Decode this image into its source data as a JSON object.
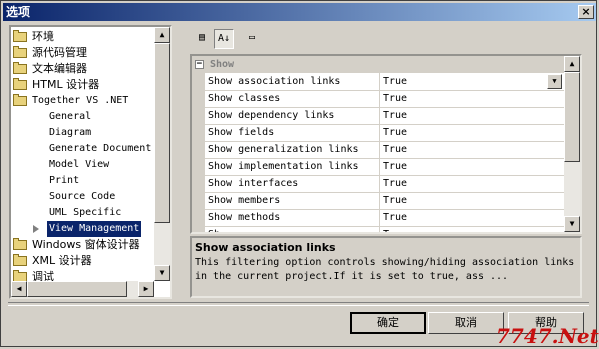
{
  "window": {
    "title": "选项",
    "close_glyph": "×"
  },
  "tree": {
    "items": [
      {
        "label": "环境"
      },
      {
        "label": "源代码管理"
      },
      {
        "label": "文本编辑器"
      },
      {
        "label": "HTML 设计器"
      },
      {
        "label": "Together VS .NET"
      },
      {
        "label": "General"
      },
      {
        "label": "Diagram"
      },
      {
        "label": "Generate Document"
      },
      {
        "label": "Model View"
      },
      {
        "label": "Print"
      },
      {
        "label": "Source Code"
      },
      {
        "label": "UML Specific"
      },
      {
        "label": "View Management"
      },
      {
        "label": "Windows 窗体设计器"
      },
      {
        "label": "XML 设计器"
      },
      {
        "label": "调试"
      }
    ],
    "selected": "View Management"
  },
  "toolbar": {
    "categorized_glyph": "▤",
    "alpha_glyph": "A↓",
    "pages_glyph": "▭"
  },
  "grid": {
    "category": "Show",
    "category_toggle": "−",
    "rows": [
      {
        "name": "Show association links",
        "value": "True"
      },
      {
        "name": "Show classes",
        "value": "True"
      },
      {
        "name": "Show dependency links",
        "value": "True"
      },
      {
        "name": "Show fields",
        "value": "True"
      },
      {
        "name": "Show generalization links",
        "value": "True"
      },
      {
        "name": "Show implementation links",
        "value": "True"
      },
      {
        "name": "Show interfaces",
        "value": "True"
      },
      {
        "name": "Show members",
        "value": "True"
      },
      {
        "name": "Show methods",
        "value": "True"
      },
      {
        "name": "Sh",
        "value": "T"
      }
    ]
  },
  "description": {
    "title": "Show association links",
    "text": "This filtering option controls showing/hiding association links in the current project.If it is set to true, ass ..."
  },
  "buttons": {
    "ok": "确定",
    "cancel": "取消",
    "help": "帮助"
  },
  "watermark": "7747.Net"
}
